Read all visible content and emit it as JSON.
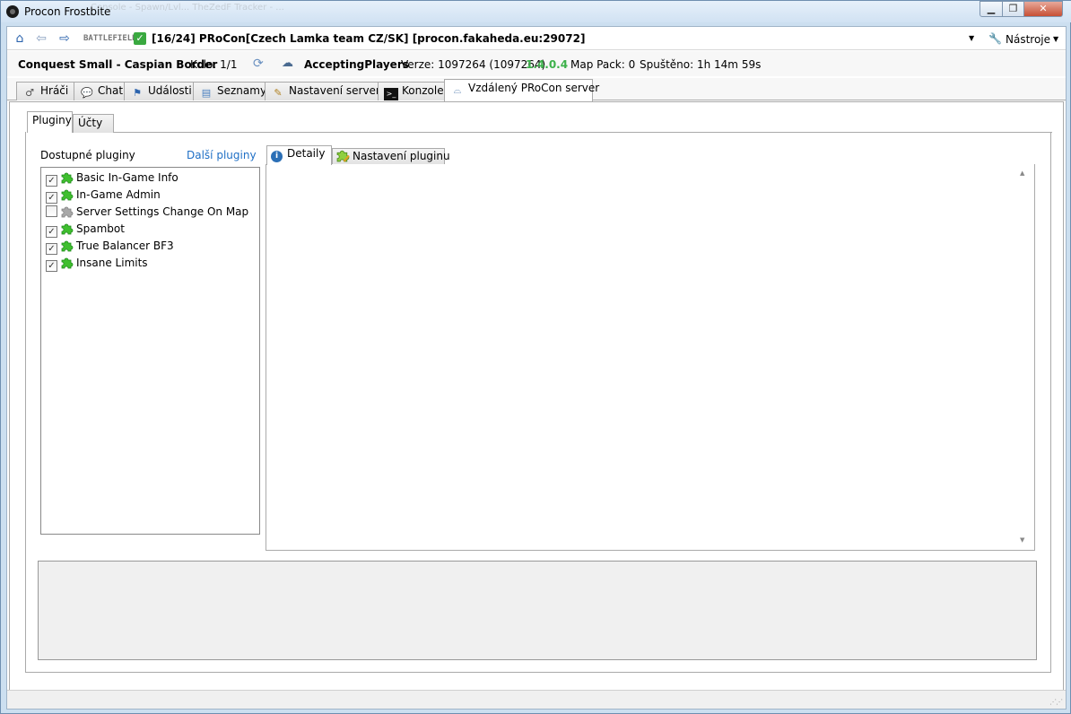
{
  "window": {
    "title": "Procon Frostbite",
    "ghost_tabs": "Console - Spawn/Lvl...   TheZedF Tracker - ...",
    "minimize_glyph": "▁",
    "maximize_glyph": "❐",
    "close_glyph": "✕"
  },
  "toolbar": {
    "home_icon": "home-icon",
    "back_icon": "back-arrow-icon",
    "forward_icon": "forward-arrow-icon",
    "game_logo_text": "BATTLEFIELD 3",
    "connected_icon": "check-icon",
    "server_title": "[16/24] PRoCon[Czech Lamka team CZ/SK] [procon.fakaheda.eu:29072]",
    "tools_label": "Nástroje",
    "dropdown_glyph": "▼"
  },
  "status": {
    "map": "Conquest Small - Caspian Border",
    "round": "Kolo: 1/1",
    "state": "AcceptingPlayers",
    "version": "Verze: 1097264 (1097264)",
    "procon_version": "1.4.0.4",
    "procon_version_color": "#3cb14a",
    "map_pack": "Map Pack: 0",
    "uptime": "Spuštěno: 1h 14m 59s"
  },
  "main_tabs": [
    {
      "label": "Hráči",
      "icon": "players-icon",
      "active": false
    },
    {
      "label": "Chat",
      "icon": "chat-icon",
      "active": false
    },
    {
      "label": "Události",
      "icon": "events-icon",
      "active": false
    },
    {
      "label": "Seznamy",
      "icon": "lists-icon",
      "active": false
    },
    {
      "label": "Nastavení serveru",
      "icon": "server-settings-icon",
      "active": false
    },
    {
      "label": "Konzole",
      "icon": "console-icon",
      "active": false
    },
    {
      "label": "Vzdálený PRoCon server",
      "icon": "remote-server-icon",
      "active": true
    }
  ],
  "sub_tabs": [
    {
      "label": "Pluginy",
      "active": true
    },
    {
      "label": "Účty",
      "active": false
    }
  ],
  "plugins": {
    "available_label": "Dostupné pluginy",
    "more_link": "Další pluginy",
    "link_color": "#1f6fc5",
    "enabled_icon_color": "#3fbf2f",
    "disabled_icon_color": "#a8a8a8",
    "items": [
      {
        "name": "Basic In-Game Info",
        "checked": true
      },
      {
        "name": "In-Game Admin",
        "checked": true
      },
      {
        "name": "Server Settings Change On Map",
        "checked": false
      },
      {
        "name": "Spambot",
        "checked": true
      },
      {
        "name": "True Balancer BF3",
        "checked": true
      },
      {
        "name": "Insane Limits",
        "checked": true
      }
    ]
  },
  "detail_tabs": [
    {
      "label": "Detaily",
      "icon": "info-icon",
      "active": true
    },
    {
      "label": "Nastavení pluginu",
      "icon": "plugin-settings-icon",
      "active": false
    }
  ]
}
